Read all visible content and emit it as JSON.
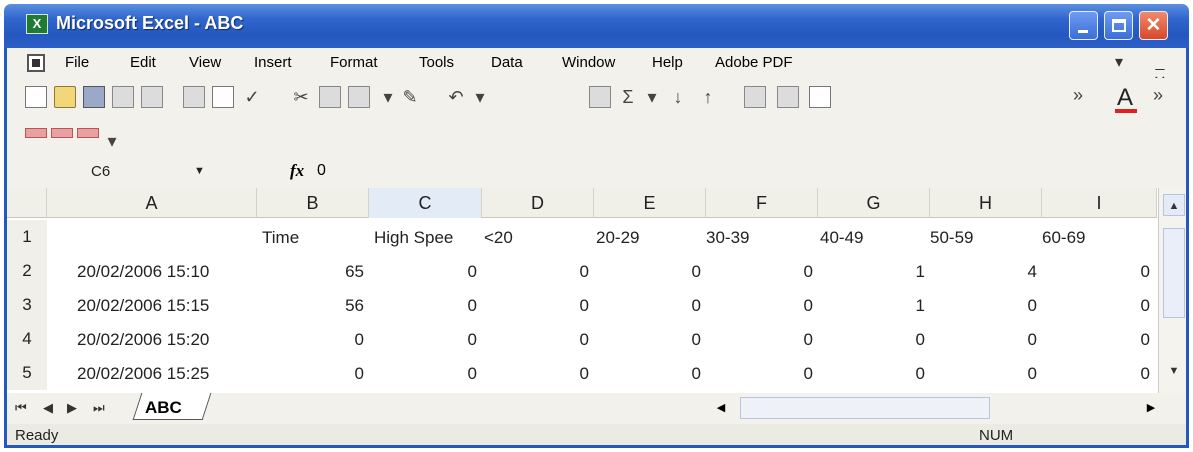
{
  "window": {
    "app_icon": "excel-icon",
    "title": "Microsoft Excel - ABC",
    "min_icon": "minimize-icon",
    "max_icon": "maximize-icon",
    "close_glyph": "✕"
  },
  "menu": {
    "items": [
      "File",
      "Edit",
      "View",
      "Insert",
      "Format",
      "Tools",
      "Data",
      "Window",
      "Help",
      "Adobe PDF"
    ],
    "mdi_controls": "▾ _ ▫ ✕"
  },
  "toolbar": {
    "icons": [
      "new-icon",
      "open-icon",
      "save-icon",
      "permission-icon",
      "email-icon",
      "print-icon",
      "print-preview-icon",
      "spelling-icon",
      "cut-icon",
      "copy-icon",
      "paste-icon",
      "format-painter-icon",
      "undo-icon",
      "web-icon",
      "autosum-icon",
      "sort-ascending-icon",
      "sort-descending-icon",
      "chart-icon",
      "drawing-icon",
      "help-icon",
      "more-buttons-icon",
      "font-color-icon"
    ],
    "font_color_label": "A",
    "font_color": "#e02020"
  },
  "formula_bar": {
    "name_box": "C6",
    "fx_label": "fx",
    "value": "0"
  },
  "sheet": {
    "columns": [
      "A",
      "B",
      "C",
      "D",
      "E",
      "F",
      "G",
      "H",
      "I"
    ],
    "active_column": "C",
    "row_numbers": [
      "1",
      "2",
      "3",
      "4",
      "5"
    ],
    "row1": [
      "",
      "Time",
      "High Spee",
      "<20",
      "20-29",
      "30-39",
      "40-49",
      "50-59",
      "60-69"
    ],
    "data_rows": [
      [
        "20/02/2006 15:10",
        "65",
        "0",
        "0",
        "0",
        "0",
        "1",
        "4",
        "0"
      ],
      [
        "20/02/2006 15:15",
        "56",
        "0",
        "0",
        "0",
        "0",
        "1",
        "0",
        "0"
      ],
      [
        "20/02/2006 15:20",
        "0",
        "0",
        "0",
        "0",
        "0",
        "0",
        "0",
        "0"
      ],
      [
        "20/02/2006 15:25",
        "0",
        "0",
        "0",
        "0",
        "0",
        "0",
        "0",
        "0"
      ]
    ]
  },
  "tabs": {
    "nav": [
      "first-sheet-icon",
      "prev-sheet-icon",
      "next-sheet-icon",
      "last-sheet-icon"
    ],
    "active": "ABC"
  },
  "status": {
    "text": "Ready",
    "num": "NUM"
  }
}
